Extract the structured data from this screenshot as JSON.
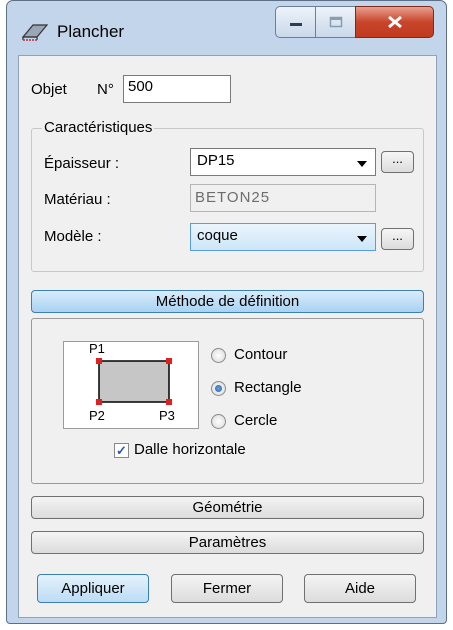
{
  "window": {
    "title": "Plancher",
    "minimize_icon": "minimize-icon",
    "maximize_icon": "maximize-icon",
    "close_icon": "close-icon",
    "close_color": "#c8452b"
  },
  "objet": {
    "label": "Objet",
    "number_label": "N°",
    "number_value": "500"
  },
  "caracteristiques": {
    "legend": "Caractéristiques",
    "epaisseur": {
      "label": "Épaisseur :",
      "value": "DP15",
      "more": "..."
    },
    "materiau": {
      "label": "Matériau :",
      "value": "BETON25"
    },
    "modele": {
      "label": "Modèle :",
      "value": "coque",
      "more": "..."
    }
  },
  "methode": {
    "header": "Méthode de définition",
    "points": {
      "p1": "P1",
      "p2": "P2",
      "p3": "P3"
    },
    "options": [
      {
        "label": "Contour",
        "selected": false
      },
      {
        "label": "Rectangle",
        "selected": true
      },
      {
        "label": "Cercle",
        "selected": false
      }
    ],
    "dalle_horizontale": {
      "label": "Dalle horizontale",
      "checked": true
    }
  },
  "sections": {
    "geometrie": "Géométrie",
    "parametres": "Paramètres"
  },
  "buttons": {
    "appliquer": "Appliquer",
    "fermer": "Fermer",
    "aide": "Aide"
  },
  "colors": {
    "accent": "#569de5",
    "window_frame": "#c2d5ea",
    "marker": "#e02020"
  }
}
